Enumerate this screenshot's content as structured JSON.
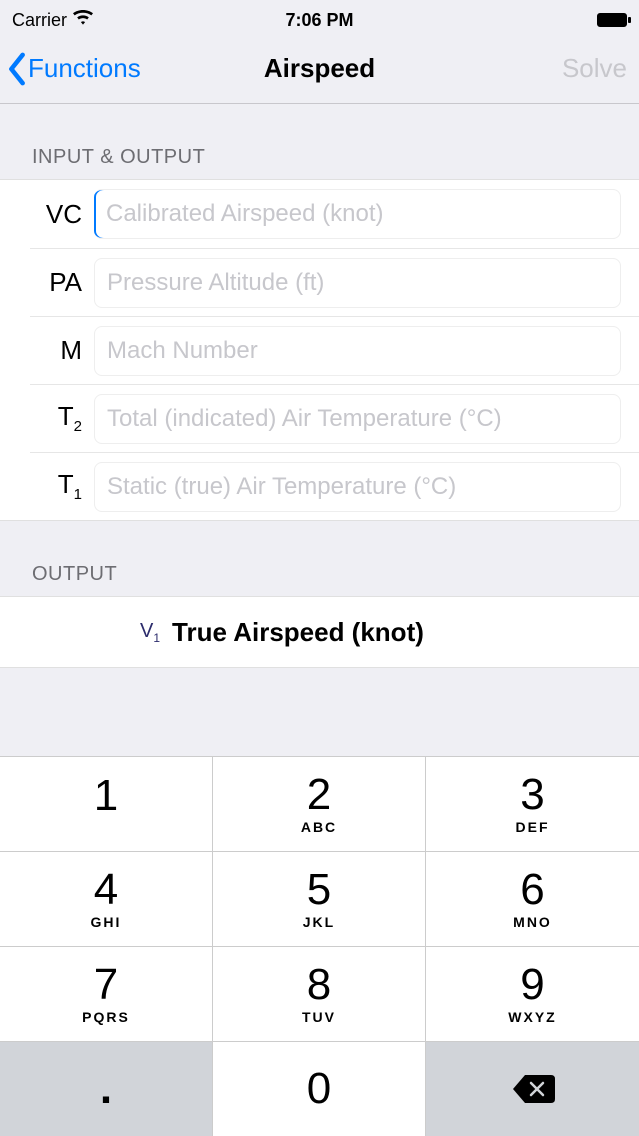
{
  "status": {
    "carrier": "Carrier",
    "time": "7:06 PM"
  },
  "nav": {
    "back": "Functions",
    "title": "Airspeed",
    "action": "Solve"
  },
  "sections": {
    "input_output": "INPUT & OUTPUT",
    "output": "OUTPUT"
  },
  "fields": {
    "vc": {
      "label": "VC",
      "placeholder": "Calibrated Airspeed (knot)"
    },
    "pa": {
      "label": "PA",
      "placeholder": "Pressure Altitude (ft)"
    },
    "m": {
      "label": "M",
      "placeholder": "Mach Number"
    },
    "t2": {
      "label_base": "T",
      "label_sub": "2",
      "placeholder": "Total (indicated) Air Temperature (°C)"
    },
    "t1": {
      "label_base": "T",
      "label_sub": "1",
      "placeholder": "Static (true) Air Temperature (°C)"
    }
  },
  "output_row": {
    "symbol_base": "V",
    "symbol_sub": "1",
    "text": "True Airspeed (knot)"
  },
  "keypad": {
    "k1": {
      "d": "1",
      "l": ""
    },
    "k2": {
      "d": "2",
      "l": "ABC"
    },
    "k3": {
      "d": "3",
      "l": "DEF"
    },
    "k4": {
      "d": "4",
      "l": "GHI"
    },
    "k5": {
      "d": "5",
      "l": "JKL"
    },
    "k6": {
      "d": "6",
      "l": "MNO"
    },
    "k7": {
      "d": "7",
      "l": "PQRS"
    },
    "k8": {
      "d": "8",
      "l": "TUV"
    },
    "k9": {
      "d": "9",
      "l": "WXYZ"
    },
    "kdot": {
      "d": "."
    },
    "k0": {
      "d": "0"
    }
  }
}
